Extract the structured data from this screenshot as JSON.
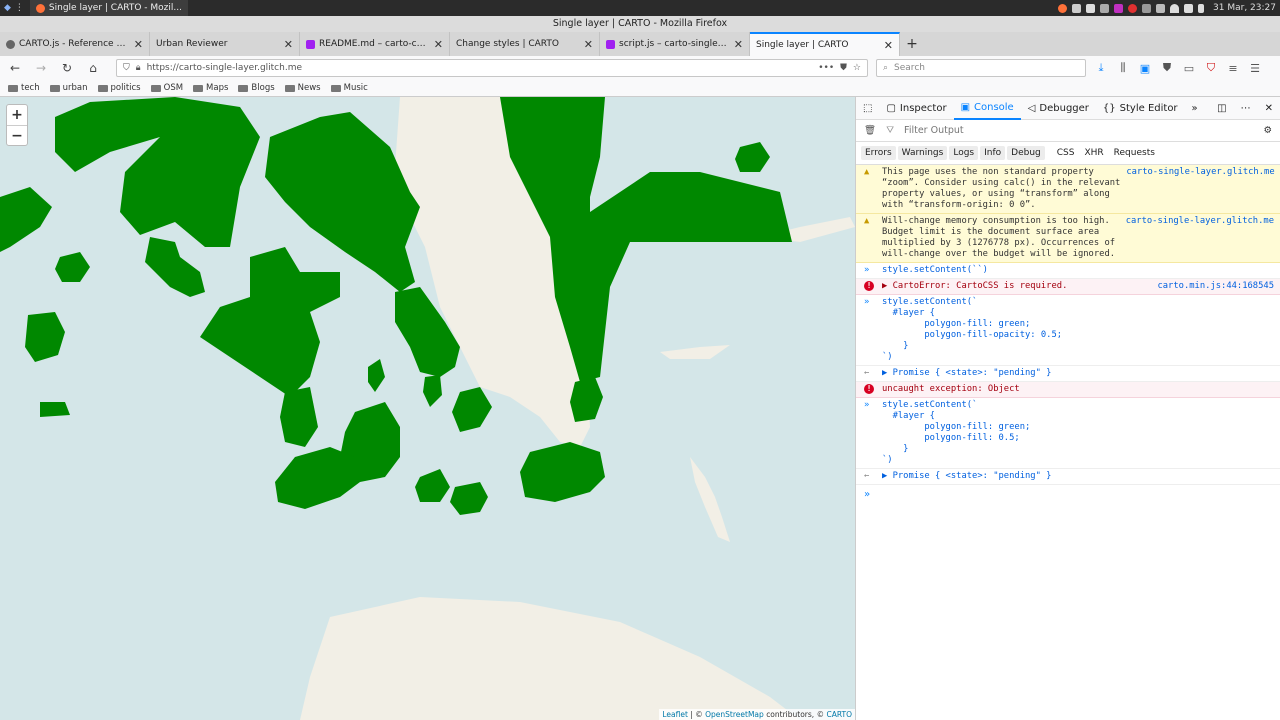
{
  "os": {
    "taskbar_task": "Single layer | CARTO - Mozil...",
    "clock": "31 Mar, 23:27"
  },
  "window": {
    "title": "Single layer | CARTO - Mozilla Firefox"
  },
  "tabs": [
    {
      "label": "CARTO.js - Reference API",
      "fav": "#666"
    },
    {
      "label": "Urban Reviewer",
      "fav": ""
    },
    {
      "label": "README.md – carto-change-s",
      "fav": "#a020f0"
    },
    {
      "label": "Change styles | CARTO",
      "fav": ""
    },
    {
      "label": "script.js – carto-single-layer",
      "fav": "#a020f0"
    },
    {
      "label": "Single layer | CARTO",
      "fav": "",
      "active": true
    }
  ],
  "nav": {
    "url": "https://carto-single-layer.glitch.me",
    "search_placeholder": "Search"
  },
  "bookmarks": [
    "tech",
    "urban",
    "politics",
    "OSM",
    "Maps",
    "Blogs",
    "News",
    "Music"
  ],
  "map": {
    "zoom_in": "+",
    "zoom_out": "−",
    "attribution": {
      "leaflet": "Leaflet",
      "sep1": "| ©",
      "osm": "OpenStreetMap",
      "mid": "contributors, ©",
      "carto": "CARTO"
    },
    "fill_color": "#008800",
    "water_color": "#d4e6e8",
    "land_color": "#f2efe6"
  },
  "devtools": {
    "tabs": [
      "Inspector",
      "Console",
      "Debugger",
      "Style Editor"
    ],
    "active_tab": "Console",
    "filter_placeholder": "Filter Output",
    "categories": [
      "Errors",
      "Warnings",
      "Logs",
      "Info",
      "Debug",
      "CSS",
      "XHR",
      "Requests"
    ],
    "messages": {
      "warn1": "This page uses the non standard property\n“zoom”. Consider using calc() in the relevant\nproperty values, or using “transform” along\nwith “transform-origin: 0 0”.",
      "warn1_src": "carto-single-layer.glitch.me",
      "warn2": "Will-change memory consumption is too high.\nBudget limit is the document surface area\nmultiplied by 3 (1276778 px). Occurrences of\nwill-change over the budget will be ignored.",
      "warn2_src": "carto-single-layer.glitch.me",
      "in1": "style.setContent(``)",
      "err1": "▶ CartoError: CartoCSS is required.",
      "err1_src": "carto.min.js:44:168545",
      "in2": "style.setContent(`\n  #layer {\n        polygon-fill: green;\n        polygon-fill-opacity: 0.5;\n    }\n`)",
      "res1": "▶ Promise { <state>: \"pending\" }",
      "err2": "uncaught exception: Object",
      "in3": "style.setContent(`\n  #layer {\n        polygon-fill: green;\n        polygon-fill: 0.5;\n    }\n`)",
      "res2": "▶ Promise { <state>: \"pending\" }"
    }
  }
}
